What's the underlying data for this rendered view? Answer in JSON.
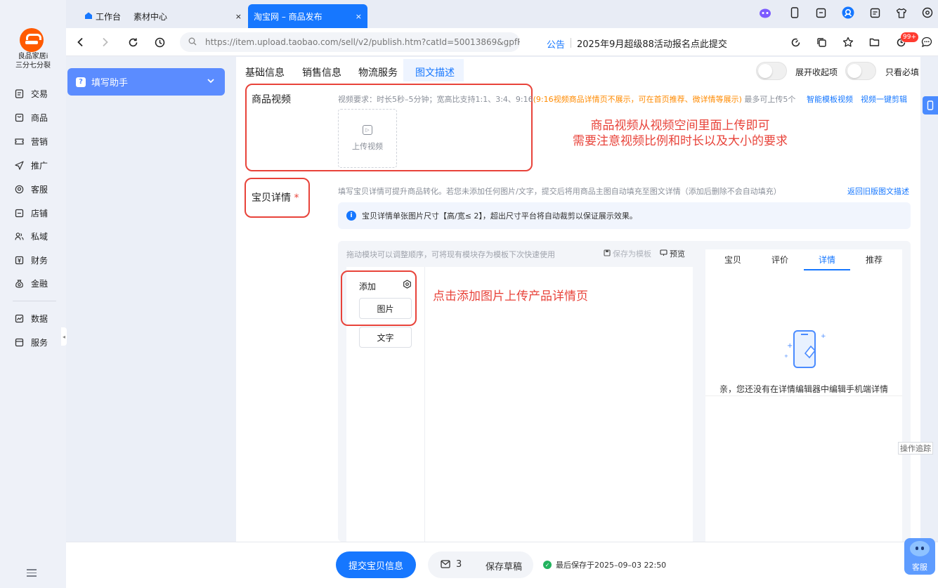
{
  "shop": {
    "name_line1": "良品家居i",
    "name_line2": "三分七分裂"
  },
  "rail": {
    "items": [
      {
        "label": "交易",
        "icon": "doc-icon"
      },
      {
        "label": "商品",
        "icon": "box-icon"
      },
      {
        "label": "营销",
        "icon": "ticket-icon"
      },
      {
        "label": "推广",
        "icon": "send-icon"
      },
      {
        "label": "客服",
        "icon": "headset-icon"
      },
      {
        "label": "店铺",
        "icon": "shop-icon"
      },
      {
        "label": "私域",
        "icon": "people-icon"
      },
      {
        "label": "财务",
        "icon": "finance-icon"
      },
      {
        "label": "金融",
        "icon": "bag-icon"
      },
      {
        "label": "数据",
        "icon": "chart-icon"
      },
      {
        "label": "服务",
        "icon": "service-icon"
      }
    ]
  },
  "tabs": [
    {
      "label": "工作台",
      "close": ""
    },
    {
      "label": "素材中心",
      "close": "×"
    },
    {
      "label": "淘宝网 – 商品发布",
      "close": "×"
    }
  ],
  "address": {
    "url": "https://item.upload.taobao.com/sell/v2/publish.htm?catId=50013869&gpfR...",
    "notice_label": "公告",
    "notice_text": "2025年9月超级88活动报名点此提交",
    "badge": "99+"
  },
  "helper": {
    "label": "填写助手"
  },
  "page_tabs": [
    "基础信息",
    "销售信息",
    "物流服务",
    "图文描述"
  ],
  "toggles": {
    "expand_label": "展开收起项",
    "required_label": "只看必填"
  },
  "video": {
    "title": "商品视频",
    "hint_prefix": "视频要求：时长5秒–5分钟；宽高比支持1:1、3:4、9:16",
    "hint_warn": "(9:16视频商品详情页不展示，可在首页推荐、微详情等展示)",
    "hint_suffix": "最多可上传5个",
    "link_template": "智能模板视频",
    "link_edit": "视频一键剪辑",
    "upload_label": "上传视频",
    "annotation_line1": "商品视频从视频空间里面上传即可",
    "annotation_line2": "需要注意视频比例和时长以及大小的要求"
  },
  "detail": {
    "title": "宝贝详情",
    "required_mark": "*",
    "hint": "填写宝贝详情可提升商品转化。若您未添加任何图片/文字，提交后将用商品主图自动填充至图文详情（添加后删除不会自动填充）",
    "link_old": "返回旧版图文描述",
    "info": "宝贝详情单张图片尺寸【高/宽≤ 2】，超出尺寸平台将自动裁剪以保证展示效果。",
    "editor_hint": "拖动模块可以调整顺序，可将现有模块存为模板下次快速使用",
    "save_template": "保存为模板",
    "preview": "预览",
    "add_label": "添加",
    "btn_image": "图片",
    "btn_text": "文字",
    "annotation": "点击添加图片上传产品详情页",
    "preview_tabs": [
      "宝贝",
      "评价",
      "详情",
      "推荐"
    ],
    "empty_text": "亲，您还没有在详情编辑器中编辑手机端详情"
  },
  "footer": {
    "submit": "提交宝贝信息",
    "draft_count": "3",
    "draft_label": "保存草稿",
    "saved_text": "最后保存于2025–09–03 22:50"
  },
  "floating": {
    "trace": "操作追踪",
    "service": "客服"
  },
  "colors": {
    "accent": "#1677ff",
    "annotation": "#e8433a",
    "warning": "#ff8a00"
  }
}
